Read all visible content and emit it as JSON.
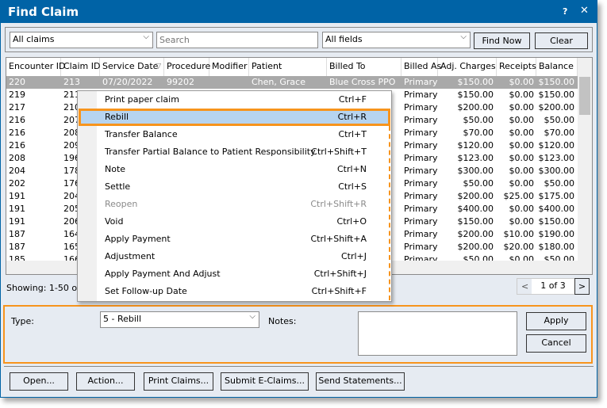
{
  "window": {
    "title": "Find Claim",
    "help": "?",
    "close": "✕"
  },
  "toolbar": {
    "filter": "All claims",
    "search_placeholder": "Search",
    "field": "All fields",
    "find_now": "Find Now",
    "clear": "Clear"
  },
  "grid": {
    "columns": [
      "Encounter ID",
      "Claim ID",
      "Service Date",
      "Procedure",
      "Modifier",
      "Patient",
      "Billed To",
      "Billed As",
      "Adj. Charges",
      "Receipts",
      "Balance"
    ],
    "sort_icon": "▽",
    "rows": [
      [
        "220",
        "213",
        "07/20/2022",
        "99202",
        "",
        "Chen, Grace",
        "Blue Cross PPO",
        "Primary",
        "$150.00",
        "$0.00",
        "$150.00"
      ],
      [
        "219",
        "211",
        "",
        "",
        "",
        "",
        "",
        "Primary",
        "$150.00",
        "$0.00",
        "$150.00"
      ],
      [
        "217",
        "210",
        "",
        "",
        "",
        "",
        "",
        "Primary",
        "$200.00",
        "$0.00",
        "$200.00"
      ],
      [
        "216",
        "207",
        "",
        "",
        "",
        "",
        "",
        "Primary",
        "$50.00",
        "$0.00",
        "$50.00"
      ],
      [
        "216",
        "208",
        "",
        "",
        "",
        "",
        "",
        "Primary",
        "$70.00",
        "$0.00",
        "$70.00"
      ],
      [
        "216",
        "209",
        "",
        "",
        "",
        "",
        "",
        "Primary",
        "$120.00",
        "$0.00",
        "$120.00"
      ],
      [
        "208",
        "196",
        "",
        "",
        "",
        "",
        "",
        "Primary",
        "$123.00",
        "$0.00",
        "$123.00"
      ],
      [
        "204",
        "178",
        "",
        "",
        "",
        "",
        "",
        "Primary",
        "$300.00",
        "$0.00",
        "$300.00"
      ],
      [
        "202",
        "176",
        "",
        "",
        "",
        "",
        "",
        "Primary",
        "$50.00",
        "$0.00",
        "$50.00"
      ],
      [
        "191",
        "204",
        "",
        "",
        "",
        "",
        "",
        "Primary",
        "$200.00",
        "$25.00",
        "$175.00"
      ],
      [
        "191",
        "205",
        "",
        "",
        "",
        "",
        "",
        "Primary",
        "$400.00",
        "$0.00",
        "$400.00"
      ],
      [
        "191",
        "206",
        "",
        "",
        "",
        "",
        "",
        "Primary",
        "$150.00",
        "$0.00",
        "$150.00"
      ],
      [
        "187",
        "164",
        "",
        "",
        "",
        "",
        "",
        "Primary",
        "$200.00",
        "$10.00",
        "$190.00"
      ],
      [
        "187",
        "165",
        "",
        "",
        "",
        "",
        "",
        "Primary",
        "$200.00",
        "$20.00",
        "$180.00"
      ],
      [
        "185",
        "166",
        "",
        "",
        "",
        "",
        "",
        "Primary",
        "$50.00",
        "$0.00",
        "$50.00"
      ]
    ]
  },
  "status": {
    "showing": "Showing: 1-50 of 1",
    "page": "1 of 3",
    "prev": "<",
    "next": ">"
  },
  "context_menu": [
    {
      "label": "Print paper claim",
      "shortcut": "Ctrl+F"
    },
    {
      "label": "Rebill",
      "shortcut": "Ctrl+R",
      "highlighted": true
    },
    {
      "label": "Transfer Balance",
      "shortcut": "Ctrl+T"
    },
    {
      "label": "Transfer Partial Balance to Patient Responsibility",
      "shortcut": "Ctrl+Shift+T"
    },
    {
      "label": "Note",
      "shortcut": "Ctrl+N"
    },
    {
      "label": "Settle",
      "shortcut": "Ctrl+S"
    },
    {
      "label": "Reopen",
      "shortcut": "Ctrl+Shift+R",
      "disabled": true
    },
    {
      "label": "Void",
      "shortcut": "Ctrl+O"
    },
    {
      "label": "Apply Payment",
      "shortcut": "Ctrl+Shift+A"
    },
    {
      "label": "Adjustment",
      "shortcut": "Ctrl+J"
    },
    {
      "label": "Apply Payment And Adjust",
      "shortcut": "Ctrl+Shift+J"
    },
    {
      "label": "Set Follow-up Date",
      "shortcut": "Ctrl+Shift+F"
    }
  ],
  "action_panel": {
    "type_label": "Type:",
    "type_value": "5 - Rebill",
    "notes_label": "Notes:",
    "notes_value": "",
    "apply": "Apply",
    "cancel": "Cancel"
  },
  "footer": {
    "open": "Open...",
    "action": "Action...",
    "print_claims": "Print Claims...",
    "submit": "Submit E-Claims...",
    "send": "Send Statements..."
  },
  "colors": {
    "title_bar": "#0063a6",
    "highlight_border": "#f7941d",
    "menu_highlight": "#b6d4f0",
    "selected_row": "#a9a9a9"
  }
}
